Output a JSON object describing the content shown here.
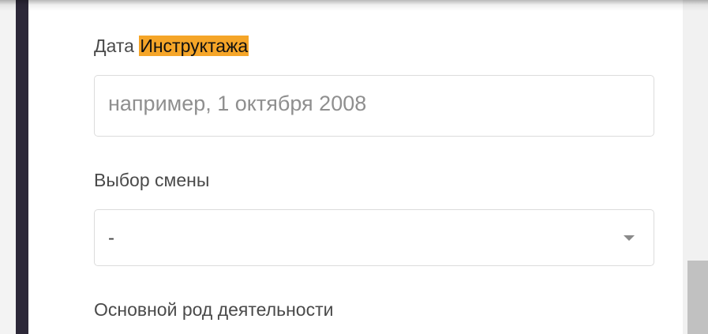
{
  "form": {
    "briefing_date": {
      "label_prefix": "Дата",
      "label_highlight": "Инструктажа",
      "placeholder": "например, 1 октября 2008"
    },
    "shift": {
      "label": "Выбор смены",
      "value": "-"
    },
    "activity": {
      "label": "Основной род деятельности"
    }
  },
  "colors": {
    "highlight": "#f5a528",
    "rail": "#2c2838"
  },
  "icons": {
    "select_caret": "caret-down-icon"
  }
}
